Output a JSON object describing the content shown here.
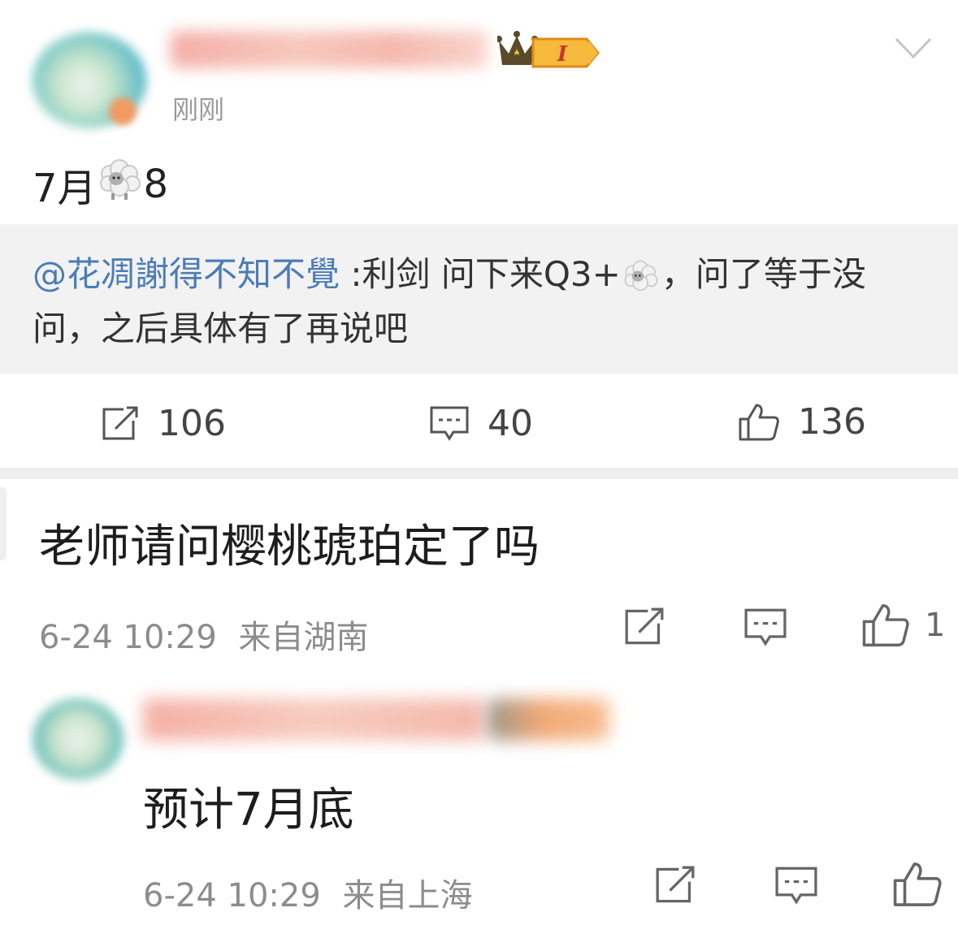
{
  "post": {
    "time": "刚刚",
    "text_prefix": "7月",
    "text_suffix": "8",
    "emoji_icon": "sheep-emoji",
    "badge_level": "I",
    "quote": {
      "mention": "@花凋謝得不知不覺",
      "text_part1": " :利剑 问下来Q3+",
      "text_part2": "，问了等于没问，之后具体有了再说吧"
    },
    "actions": {
      "repost_count": "106",
      "comment_count": "40",
      "like_count": "136"
    }
  },
  "comments": [
    {
      "text": "老师请问樱桃琥珀定了吗",
      "time": "6-24 10:29",
      "location": "来自湖南",
      "like_count": "1"
    },
    {
      "text": "预计7月底",
      "time": "6-24 10:29",
      "location": "来自上海"
    }
  ],
  "colors": {
    "mention_blue": "#4b7cb8",
    "quote_bg": "#f2f2f2",
    "meta_gray": "#8c8c8c",
    "badge_orange": "#f5a623"
  }
}
